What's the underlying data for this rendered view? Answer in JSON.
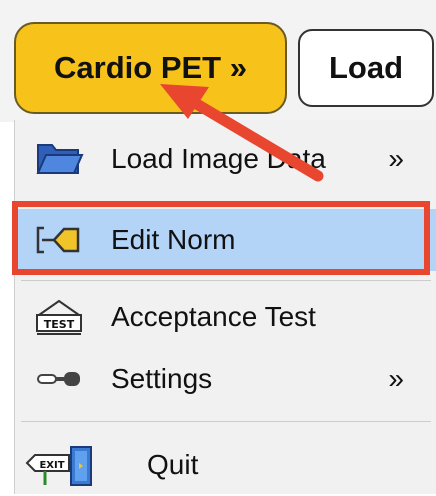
{
  "toolbar": {
    "cardio_label": "Cardio PET »",
    "load_label": "Load"
  },
  "menu": {
    "items": [
      {
        "label": "Load Image Data",
        "icon": "folder-icon",
        "submenu": "»"
      },
      {
        "label": "Edit Norm",
        "icon": "edit-norm-icon",
        "selected": true
      },
      {
        "label": "Acceptance Test",
        "icon": "test-icon"
      },
      {
        "label": "Settings",
        "icon": "settings-icon",
        "submenu": "»"
      },
      {
        "label": "Quit",
        "icon": "exit-icon"
      }
    ]
  },
  "icon_text": {
    "test": "TEST",
    "exit": "EXIT"
  },
  "colors": {
    "accent": "#f7c21a",
    "selection": "#b3d3f7",
    "annotation": "#e8462e"
  }
}
